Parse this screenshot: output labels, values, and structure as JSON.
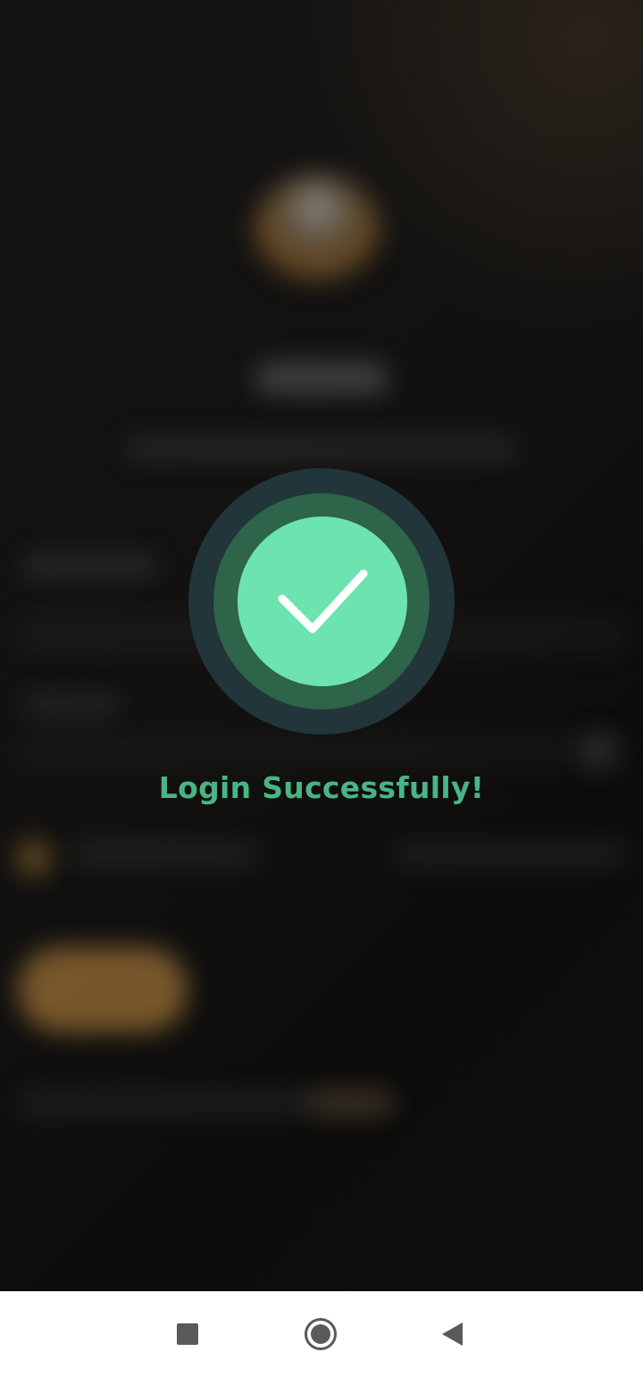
{
  "overlay": {
    "message": "Login Successfully!",
    "icon": "check-icon",
    "colors": {
      "outer_ring": "#21353a",
      "middle_ring": "#2e644a",
      "inner_circle": "#6de3b0",
      "checkmark": "#ffffff",
      "message_text": "#49b584"
    }
  },
  "background_app": {
    "state": "blurred"
  },
  "navigation_bar": {
    "buttons": [
      {
        "name": "recent-apps",
        "icon": "square-icon"
      },
      {
        "name": "home",
        "icon": "circle-icon"
      },
      {
        "name": "back",
        "icon": "triangle-back-icon"
      }
    ]
  }
}
